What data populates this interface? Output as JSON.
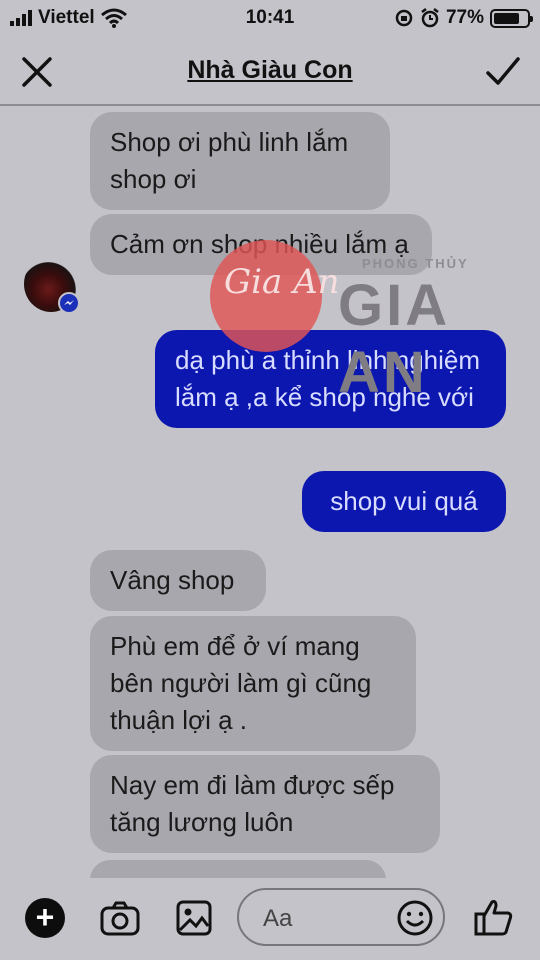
{
  "status_bar": {
    "carrier": "Viettel",
    "time": "10:41",
    "battery": "77%",
    "battery_level": 0.77
  },
  "header": {
    "title": "Nhà Giàu Con"
  },
  "watermark": {
    "brand_small": "PHONG THỦY",
    "brand_big": "GIA AN"
  },
  "messages": [
    {
      "direction": "in",
      "text": "Shop ơi phù linh lắm shop ơi"
    },
    {
      "direction": "in",
      "text": "Cảm ơn shop nhiều lắm ạ"
    },
    {
      "direction": "out",
      "text": "dạ phù a thỉnh linh nghiệm lắm ạ ,a kể shop nghe với"
    },
    {
      "direction": "out",
      "text": "shop vui quá"
    },
    {
      "direction": "in",
      "text": "Vâng shop"
    },
    {
      "direction": "in",
      "text": "Phù em để ở ví mang bên người làm gì cũng thuận lợi ạ ."
    },
    {
      "direction": "in",
      "text": "Nay em đi làm được sếp tăng lương luôn"
    }
  ],
  "composer": {
    "placeholder": "Aa"
  },
  "colors": {
    "background": "#c4c3c9",
    "incoming_bubble": "#a8a7ad",
    "outgoing_bubble": "#0c17b0"
  }
}
